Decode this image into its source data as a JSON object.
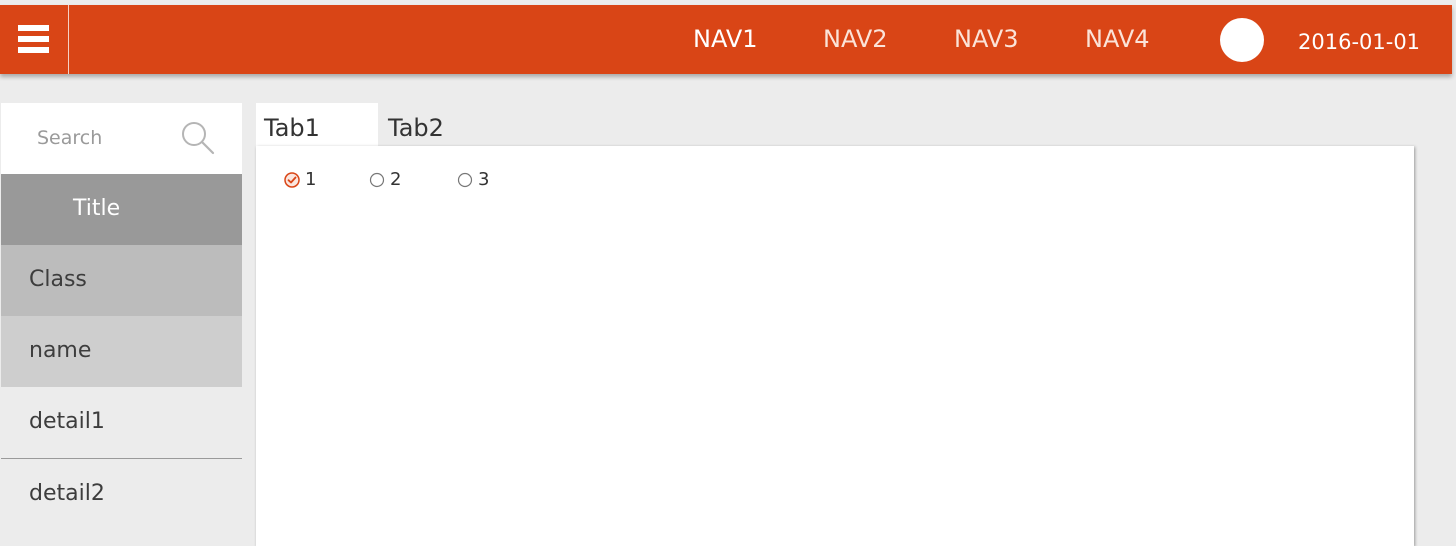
{
  "header": {
    "nav": [
      "NAV1",
      "NAV2",
      "NAV3",
      "NAV4"
    ],
    "active_nav": "NAV1",
    "date": "2016-01-01",
    "menu_icon": "hamburger-menu-icon",
    "avatar": "avatar"
  },
  "colors": {
    "accent": "#d94516",
    "title_row": "#999999",
    "class_row": "#bcbcbc",
    "name_row": "#cecece",
    "background": "#ececec"
  },
  "sidebar": {
    "search": {
      "placeholder": "Search",
      "value": "",
      "icon": "search-icon"
    },
    "title": "Title",
    "class": "Class",
    "name": "name",
    "details": [
      "detail1",
      "detail2"
    ]
  },
  "tabs": {
    "items": [
      "Tab1",
      "Tab2"
    ],
    "active": "Tab1"
  },
  "radios": {
    "options": [
      "1",
      "2",
      "3"
    ],
    "selected": "1"
  }
}
